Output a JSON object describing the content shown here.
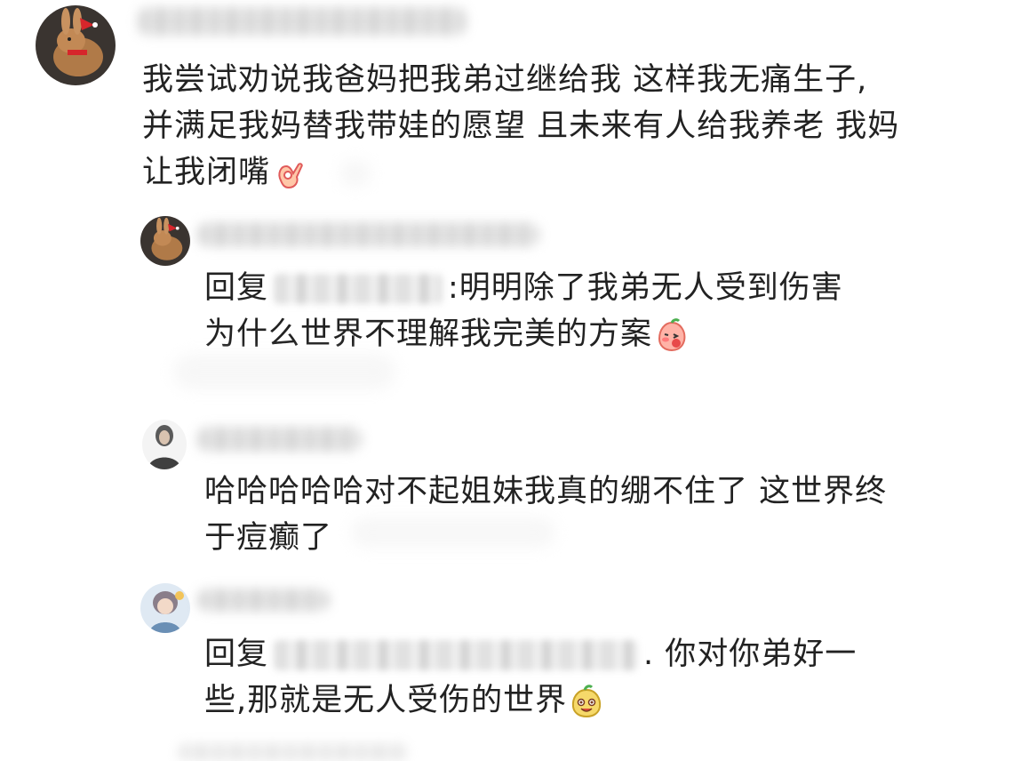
{
  "comments": [
    {
      "lines": [
        "我尝试劝说我爸妈把我弟过继给我 这样我无痛生子,",
        "并满足我妈替我带娃的愿望 且未来有人给我养老 我妈",
        "让我闭嘴"
      ],
      "emoji": "ok-hand-icon"
    },
    {
      "reply_prefix": "回复",
      "line1_after": ":明明除了我弟无人受到伤害",
      "line2": "为什么世界不理解我完美的方案",
      "emoji": "blushing-peach-icon"
    },
    {
      "lines": [
        "哈哈哈哈哈对不起姐妹我真的绷不住了 这世界终",
        "于痘癫了"
      ]
    },
    {
      "reply_prefix": "回复",
      "line1_after": ". 你对你弟好一",
      "line2": "些,那就是无人受伤的世界",
      "emoji": "smiling-face-icon"
    }
  ]
}
